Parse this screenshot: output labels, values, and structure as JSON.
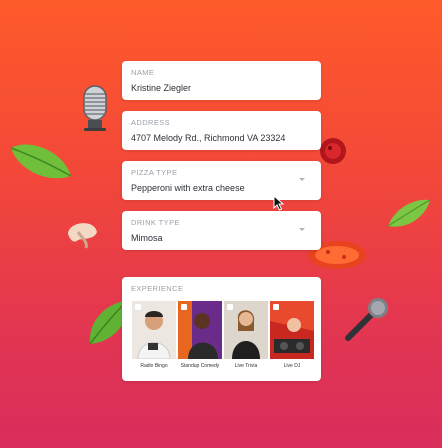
{
  "form": {
    "name": {
      "label": "NAME",
      "value": "Kristine Ziegler"
    },
    "address": {
      "label": "ADDRESS",
      "value": "4707  Melody Rd., Richmond VA 23324"
    },
    "pizza": {
      "label": "PIZZA TYPE",
      "value": "Pepperoni with extra cheese"
    },
    "drink": {
      "label": "DRINK TYPE",
      "value": "Mimosa"
    }
  },
  "experience": {
    "label": "EXPERIENCE",
    "options": [
      {
        "caption": "Radio Bingo"
      },
      {
        "caption": "Standup Comedy"
      },
      {
        "caption": "Live Trivia"
      },
      {
        "caption": "Live DJ"
      }
    ]
  },
  "icons": [
    "microphone-icon",
    "basil-leaf-icon",
    "mushroom-icon",
    "tomato-icon",
    "pepperoni-icon",
    "chevron-down-icon",
    "cursor-icon"
  ],
  "colors": {
    "background_top": "#ff5a2a",
    "background_bottom": "#d92d5c"
  }
}
